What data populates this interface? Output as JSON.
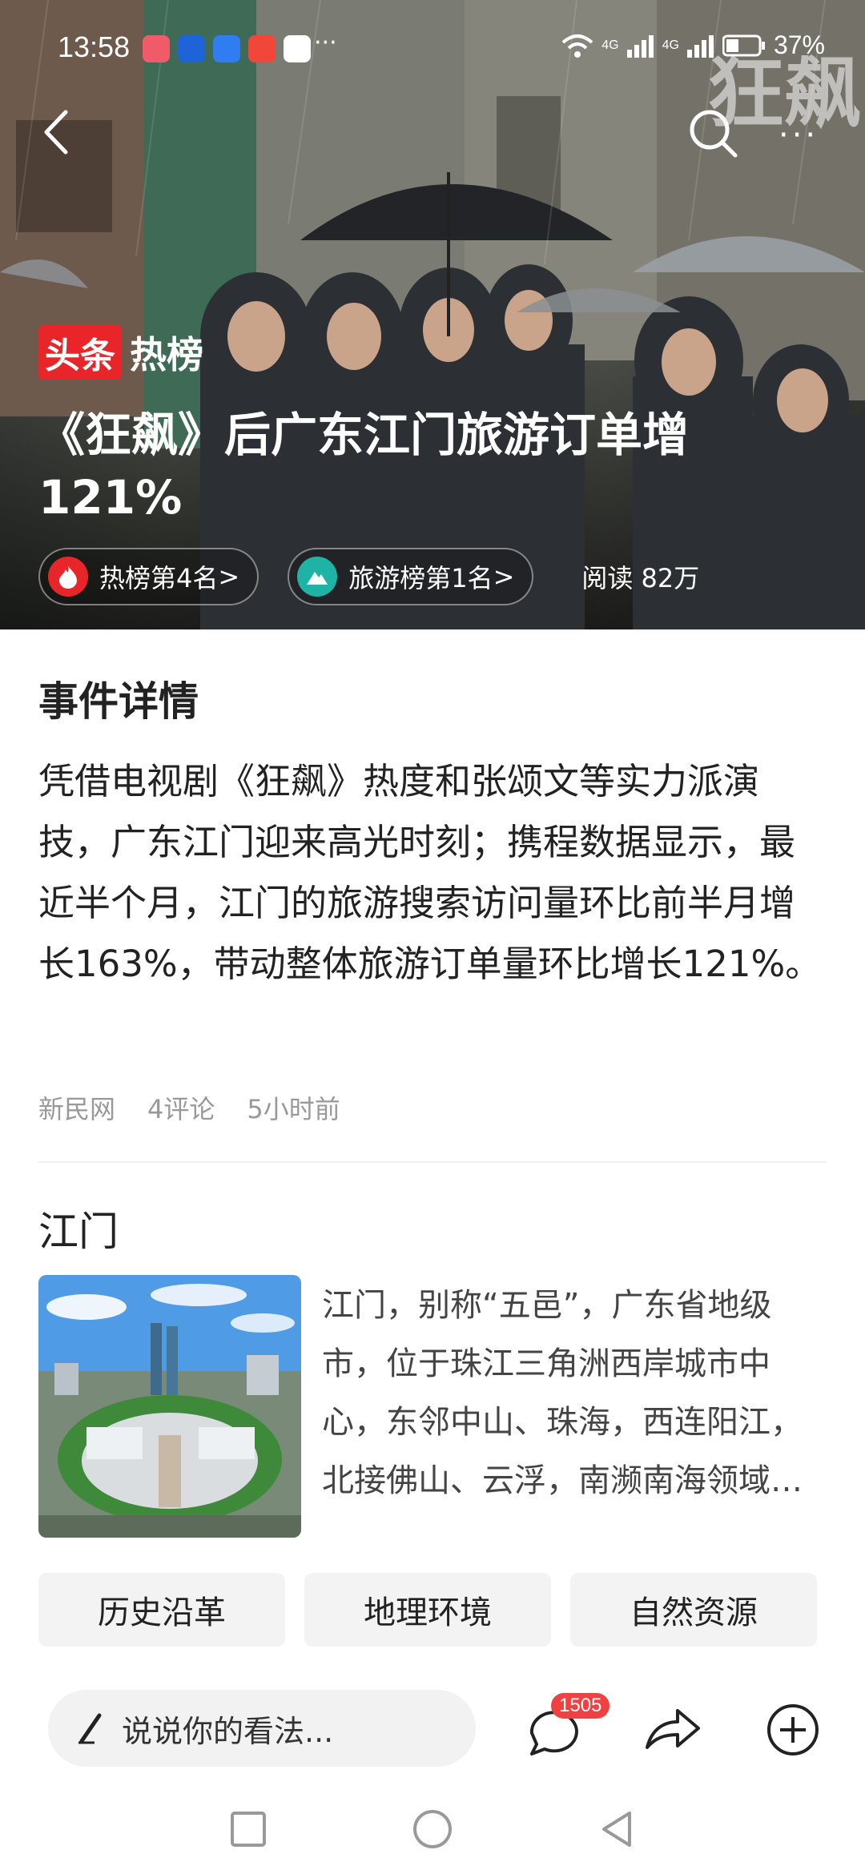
{
  "status_bar": {
    "time": "13:58",
    "more": "···",
    "network_label": "4G",
    "battery": "37%"
  },
  "hero": {
    "nav_more": "···",
    "watermark": "狂飙",
    "badge_prefix": "头条",
    "badge_suffix": "热榜",
    "title": "《狂飙》后广东江门旅游订单增121%",
    "tags": [
      {
        "label": "热榜第4名",
        "chevron": ">"
      },
      {
        "label": "旅游榜第1名",
        "chevron": ">"
      }
    ],
    "reads": "阅读 82万"
  },
  "details": {
    "heading": "事件详情",
    "body": "凭借电视剧《狂飙》热度和张颂文等实力派演技，广东江门迎来高光时刻；携程数据显示，最近半个月，江门的旅游搜索访问量环比前半月增长163%，带动整体旅游订单量环比增长121%。",
    "source": "新民网",
    "comments": "4评论",
    "time_ago": "5小时前"
  },
  "city": {
    "name": "江门",
    "description": "江门，别称“五邑”，广东省地级市，位于珠江三角洲西岸城市中心，东邻中山、珠海，西连阳江，北接佛山、云浮，南濒南海领域…",
    "chips": [
      "历史沿革",
      "地理环境",
      "自然资源"
    ]
  },
  "comment_bar": {
    "placeholder": "说说你的看法...",
    "comment_count": "1505"
  },
  "colors": {
    "accent_red": "#e8262a",
    "teal": "#1fb3a6",
    "badge_red": "#f04142"
  }
}
